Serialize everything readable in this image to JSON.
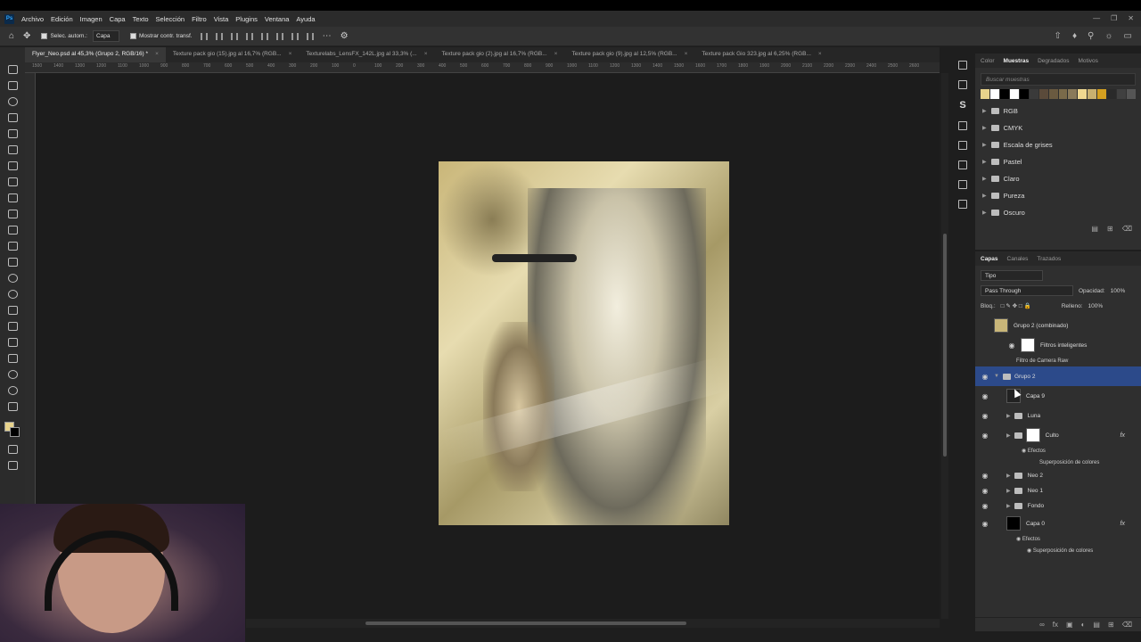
{
  "menubar": {
    "logo": "Ps",
    "items": [
      "Archivo",
      "Edición",
      "Imagen",
      "Capa",
      "Texto",
      "Selección",
      "Filtro",
      "Vista",
      "Plugins",
      "Ventana",
      "Ayuda"
    ]
  },
  "options": {
    "auto_select_label": "Selec. autom.:",
    "auto_select_target": "Capa",
    "show_transform_label": "Mostrar contr. transf."
  },
  "tabs": [
    {
      "label": "Flyer_Neo.psd al 45,3% (Grupo 2, RGB/16) *",
      "active": true
    },
    {
      "label": "Texture pack gio (15).jpg al 16,7% (RGB...",
      "active": false
    },
    {
      "label": "Texturelabs_LensFX_142L.jpg al 33,3% (...",
      "active": false
    },
    {
      "label": "Texture pack gio (2).jpg al 16,7% (RGB...",
      "active": false
    },
    {
      "label": "Texture pack gio (9).jpg al 12,5% (RGB...",
      "active": false
    },
    {
      "label": "Texture pack Gio 323.jpg al 6,25% (RGB...",
      "active": false
    }
  ],
  "ruler_ticks": [
    "1500",
    "1400",
    "1300",
    "1200",
    "1100",
    "1000",
    "900",
    "800",
    "700",
    "600",
    "500",
    "400",
    "300",
    "200",
    "100",
    "0",
    "100",
    "200",
    "300",
    "400",
    "500",
    "600",
    "700",
    "800",
    "900",
    "1000",
    "1100",
    "1200",
    "1300",
    "1400",
    "1500",
    "1600",
    "1700",
    "1800",
    "1900",
    "2000",
    "2100",
    "2200",
    "2300",
    "2400",
    "2500",
    "2600"
  ],
  "swatches_panel": {
    "tabs": [
      "Color",
      "Muestras",
      "Degradados",
      "Motivos"
    ],
    "active_tab": "Muestras",
    "search_placeholder": "Buscar muestras",
    "colors": [
      "#e8d38c",
      "#ffffff",
      "#000000",
      "#ffffff",
      "#000000",
      "#3a3a3a",
      "#5a4a3a",
      "#6a5a40",
      "#7a6a4a",
      "#8a7a5a",
      "#f0d890",
      "#c8b070",
      "#d4a020",
      "#2a2a2a",
      "#404040",
      "#555555"
    ],
    "folders": [
      "RGB",
      "CMYK",
      "Escala de grises",
      "Pastel",
      "Claro",
      "Pureza",
      "Oscuro"
    ]
  },
  "layers_panel": {
    "tabs": [
      "Capas",
      "Canales",
      "Trazados"
    ],
    "active_tab": "Capas",
    "filter_label": "Tipo",
    "blend_mode": "Pass Through",
    "opacity_label": "Opacidad:",
    "opacity_value": "100%",
    "lock_label": "Bloq.:",
    "fill_label": "Relleno:",
    "fill_value": "100%",
    "layers": {
      "grupo2_combined": "Grupo 2 (combinado)",
      "smart_filters": "Filtros inteligentes",
      "camera_raw": "Filtro de Camera Raw",
      "grupo2": "Grupo 2",
      "capa9": "Capa 9",
      "luna": "Luna",
      "culto": "Culto",
      "culto_effects": "Efectos",
      "culto_overlay": "Superposición de colores",
      "neo2": "Neo 2",
      "neo1": "Neo 1",
      "fondo": "Fondo",
      "capa0": "Capa 0",
      "capa0_effects": "Efectos",
      "capa0_overlay": "Superposición de colores"
    }
  }
}
